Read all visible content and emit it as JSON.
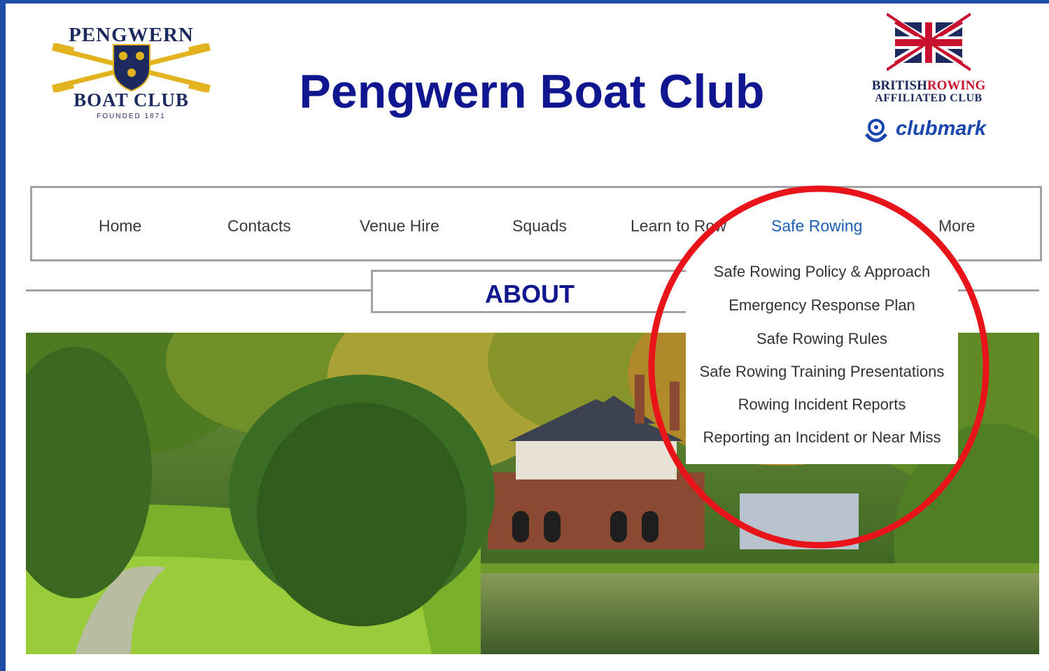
{
  "colors": {
    "frame": "#1c4ea6",
    "title": "#10168f",
    "active_nav": "#1a5fb4",
    "annotation": "#e8141a",
    "border": "#a3a3a3"
  },
  "logo": {
    "top_text": "PENGWERN",
    "bottom_text": "BOAT CLUB",
    "founded_text": "FOUNDED 1871"
  },
  "header": {
    "title": "Pengwern Boat Club"
  },
  "affiliation": {
    "british": "BRITISH",
    "rowing": "ROWING",
    "affiliated": "AFFILIATED CLUB",
    "clubmark": "clubmark"
  },
  "nav": {
    "items": [
      {
        "label": "Home"
      },
      {
        "label": "Contacts"
      },
      {
        "label": "Venue Hire"
      },
      {
        "label": "Squads"
      },
      {
        "label": "Learn to Row"
      },
      {
        "label": "Safe Rowing"
      },
      {
        "label": "More"
      }
    ],
    "active": "Safe Rowing"
  },
  "section": {
    "title": "ABOUT"
  },
  "dropdown": {
    "items": [
      {
        "label": "Safe Rowing Policy & Approach"
      },
      {
        "label": "Emergency Response Plan"
      },
      {
        "label": "Safe Rowing Rules"
      },
      {
        "label": "Safe Rowing Training Presentations"
      },
      {
        "label": "Rowing Incident Reports"
      },
      {
        "label": "Reporting an Incident or Near Miss"
      }
    ]
  },
  "icons": [
    "crossed-oars-icon",
    "crest-icon",
    "union-jack-icon",
    "clubmark-icon"
  ]
}
